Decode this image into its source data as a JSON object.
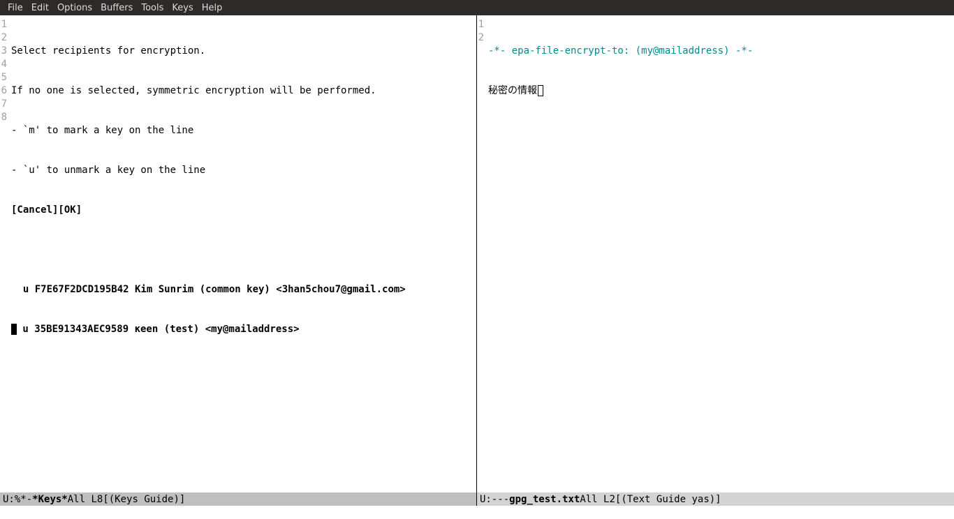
{
  "menu": {
    "items": [
      "File",
      "Edit",
      "Options",
      "Buffers",
      "Tools",
      "Keys",
      "Help"
    ]
  },
  "left_pane": {
    "line_numbers": [
      "1",
      "2",
      "3",
      "4",
      "5",
      "6",
      "7",
      "8"
    ],
    "lines": {
      "l1": "Select recipients for encryption.",
      "l2": "If no one is selected, symmetric encryption will be performed.",
      "l3": "- `m' to mark a key on the line",
      "l4": "- `u' to unmark a key on the line",
      "l5": "[Cancel][OK]",
      "l6": "",
      "l7": "  u F7E67F2DCD195B42 Kim Sunrim (common key) <3han5chou7@gmail.com>",
      "l8_prefix": "",
      "l8_rest": " u 35BE91343AEC9589 κeen (test) <my@mailaddress>"
    },
    "modeline": {
      "status": "U:%*-",
      "buffer_name": "*Keys*",
      "position": "All L8",
      "mode": "[(Keys Guide)]"
    }
  },
  "right_pane": {
    "line_numbers": [
      "1",
      "2"
    ],
    "lines": {
      "l1": "-*- epa-file-encrypt-to: (my@mailaddress) -*-",
      "l2": "秘密の情報"
    },
    "modeline": {
      "status": "U:---",
      "buffer_name": "gpg_test.txt",
      "position": "All L2",
      "mode": "[(Text Guide yas)]"
    }
  }
}
